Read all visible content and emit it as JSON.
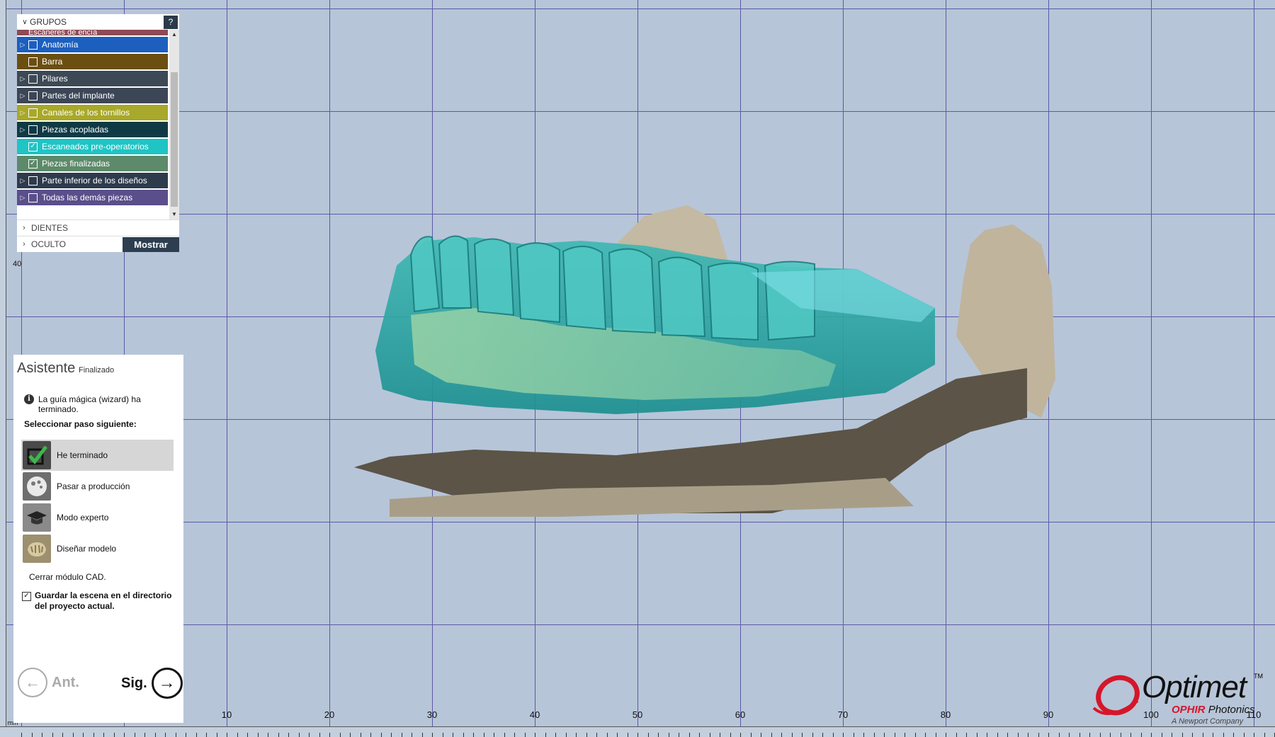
{
  "groups_panel": {
    "title": "GRUPOS",
    "help_label": "?",
    "partial_top_label": "Escáneres de encía",
    "items": [
      {
        "label": "Anatomía",
        "color": "#1c5fbf",
        "checked": false,
        "expandable": true
      },
      {
        "label": "Barra",
        "color": "#6b4f10",
        "checked": false,
        "expandable": false
      },
      {
        "label": "Pilares",
        "color": "#3d4a55",
        "checked": false,
        "expandable": true
      },
      {
        "label": "Partes del implante",
        "color": "#3c4656",
        "checked": false,
        "expandable": true
      },
      {
        "label": "Canales de los tornillos",
        "color": "#a8a82a",
        "checked": false,
        "expandable": true
      },
      {
        "label": "Piezas acopladas",
        "color": "#0f3a45",
        "checked": false,
        "expandable": true
      },
      {
        "label": "Escaneados pre-operatorios",
        "color": "#1fc4c4",
        "checked": true,
        "expandable": false
      },
      {
        "label": "Piezas finalizadas",
        "color": "#5d8a6a",
        "checked": true,
        "expandable": false
      },
      {
        "label": "Parte inferior de los diseños",
        "color": "#2e3b4d",
        "checked": false,
        "expandable": true
      },
      {
        "label": "Todas las demás piezas",
        "color": "#5a4f8a",
        "checked": false,
        "expandable": true
      }
    ],
    "teeth_label": "DIENTES",
    "hidden_label": "OCULTO",
    "show_button": "Mostrar"
  },
  "wizard": {
    "title": "Asistente",
    "status": "Finalizado",
    "info_text": "La guía mágica (wizard) ha terminado.",
    "select_prompt": "Seleccionar paso siguiente:",
    "steps": [
      {
        "label": "He terminado",
        "icon": "checkmark-icon",
        "selected": true
      },
      {
        "label": "Pasar a producción",
        "icon": "production-icon",
        "selected": false
      },
      {
        "label": "Modo experto",
        "icon": "graduation-cap-icon",
        "selected": false
      },
      {
        "label": "Diseñar modelo",
        "icon": "model-icon",
        "selected": false
      }
    ],
    "close_cad": "Cerrar módulo CAD.",
    "save_scene": "Guardar la escena en el directorio del proyecto actual.",
    "save_scene_checked": true,
    "prev_label": "Ant.",
    "next_label": "Sig."
  },
  "rulers": {
    "bottom_labels": [
      "10",
      "20",
      "30",
      "40",
      "50",
      "60",
      "70",
      "80",
      "90",
      "100",
      "110"
    ],
    "left_label": "40",
    "origin_label": "mm"
  },
  "logo": {
    "name": "Optimet",
    "trademark": "TM",
    "sub_brand": "OPHIR",
    "sub_suffix": "Photonics",
    "company": "A Newport Company",
    "brand_red": "#d6162a"
  }
}
